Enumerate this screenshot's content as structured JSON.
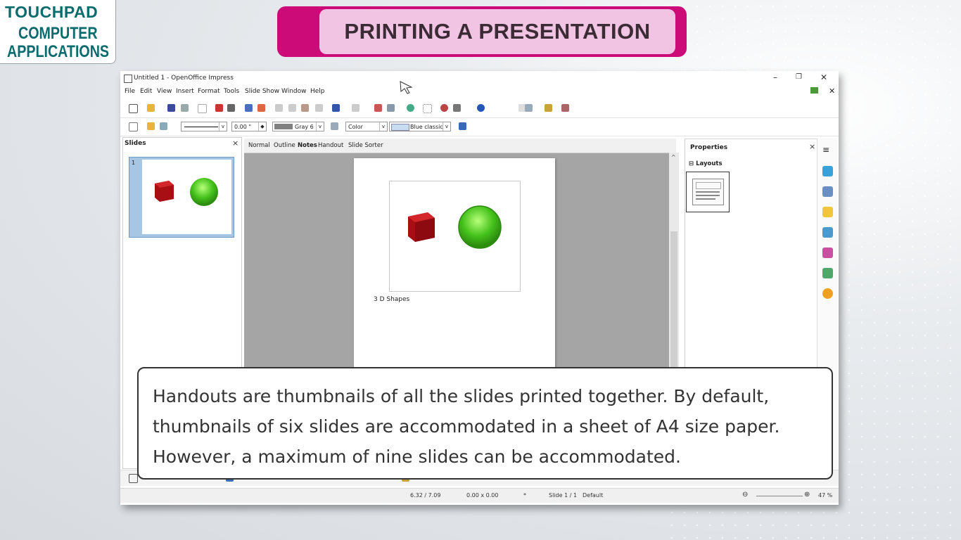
{
  "logo": {
    "brand": "TOUCHPAD",
    "line2": "COMPUTER",
    "line3": "APPLICATIONS"
  },
  "heading": "PRINTING A PRESENTATION",
  "window": {
    "title": "Untitled 1 - OpenOffice Impress",
    "controls": {
      "minimize": "–",
      "maximize": "❐",
      "close": "✕"
    },
    "menu": [
      "File",
      "Edit",
      "View",
      "Insert",
      "Format",
      "Tools",
      "Slide Show",
      "Window",
      "Help"
    ],
    "line_width": "0.00 \"",
    "fill_color": "Gray 6",
    "fill_type": "Color",
    "fill_value": "Blue classic",
    "slides_pane": {
      "title": "Slides",
      "close": "×",
      "slide_number": "1"
    },
    "view_tabs": [
      "Normal",
      "Outline",
      "Notes",
      "Handout",
      "Slide Sorter"
    ],
    "active_tab": "Notes",
    "notes_text": "3 D Shapes",
    "properties": {
      "title": "Properties",
      "close": "×",
      "section": "Layouts",
      "expander": "⊟"
    },
    "status": {
      "position": "6.32 / 7.09",
      "size": "0.00 x 0.00",
      "modified": "*",
      "slide": "Slide 1 / 1",
      "master": "Default",
      "zoom": "47 %"
    }
  },
  "caption": "Handouts are thumbnails of all the slides printed together. By default, thumbnails of six slides are accommodated in a sheet of A4 size paper. However, a maximum of nine slides can be accommodated.",
  "colors": {
    "heading_outer": "#cc0a78",
    "heading_inner": "#f2c4e4",
    "logo": "#0b6b6e",
    "thumb_selected": "#a7c6e4"
  }
}
